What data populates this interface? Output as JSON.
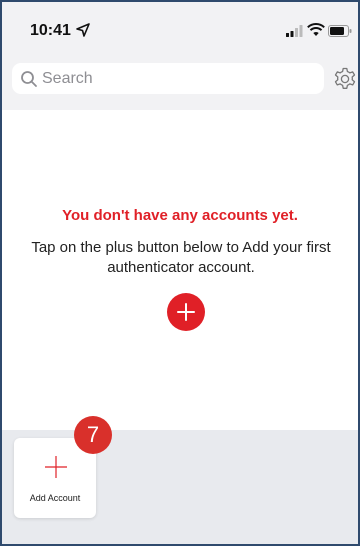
{
  "status_bar": {
    "time": "10:41",
    "icons": [
      "location-arrow-icon",
      "signal-icon",
      "wifi-icon",
      "battery-icon"
    ]
  },
  "search": {
    "placeholder": "Search",
    "icon": "search-icon"
  },
  "header": {
    "settings_icon": "gear-icon"
  },
  "empty_state": {
    "title": "You don't have any accounts yet.",
    "description": "Tap on the plus button below to Add your first authenticator account.",
    "add_icon": "plus-icon"
  },
  "bottom_tray": {
    "add_account_label": "Add Account",
    "step_badge": "7"
  },
  "colors": {
    "accent_red": "#e02027",
    "badge_red": "#d9302b",
    "header_gray": "#f2f2f4",
    "tray_gray": "#e8eaee"
  }
}
